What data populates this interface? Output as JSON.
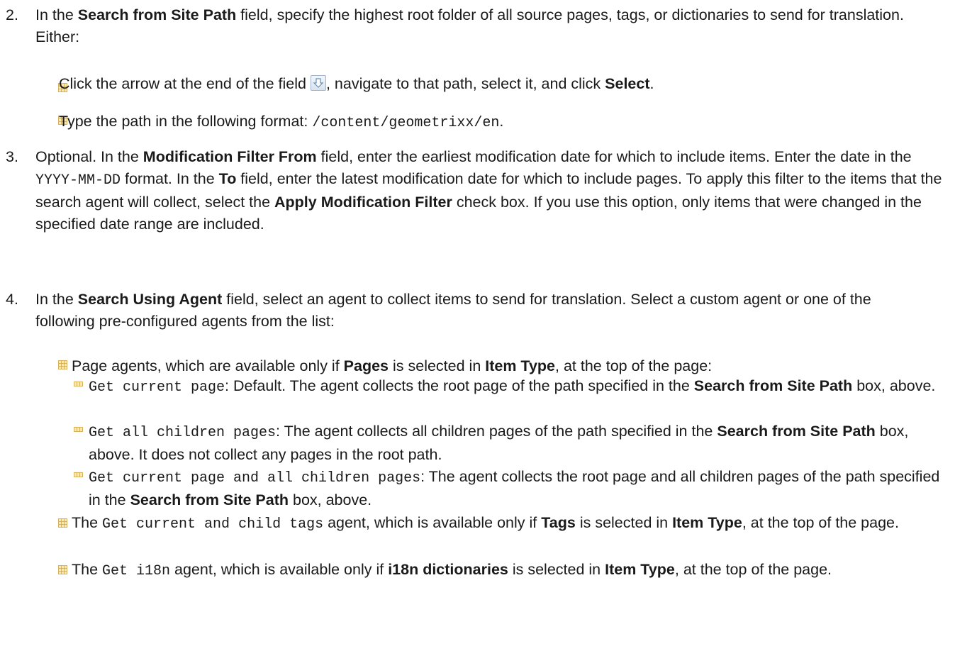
{
  "step2": {
    "num": "2.",
    "p1": "In the ",
    "b1": "Search from Site Path",
    "p2": " field, specify the highest root folder of all source pages, tags, or dictionaries to send for translation. Either:",
    "bullets": [
      {
        "p1": "Click the arrow at the end of the field ",
        "p2": ", navigate to that path, select it, and click ",
        "b1": "Select",
        "p3": "."
      },
      {
        "p1": "Type the path in the following format: ",
        "code": "/content/geometrixx/en",
        "p2": "."
      }
    ]
  },
  "step3": {
    "num": "3.",
    "p1": "Optional. In the ",
    "b1": "Modification Filter From",
    "p2": " field, enter the earliest modification date for which to include items. Enter the date in the ",
    "code": "YYYY-MM-DD",
    "p3": " format. In the ",
    "b2": "To",
    "p4": " field, enter the latest modification date for which to include pages. To apply this filter to the items that the search agent will collect, select the ",
    "b3": "Apply Modification Filter",
    "p5": " check box. If you use this option, only items that were changed in the specified date range are included."
  },
  "step4": {
    "num": "4.",
    "p1": "In the ",
    "b1": "Search Using Agent",
    "p2": " field, select an agent to collect items to send for translation. Select a custom agent or one of the following pre-configured agents from the list:",
    "page_agents": {
      "p1": "Page agents, which are available only if ",
      "b1": "Pages",
      "p2": " is selected in ",
      "b2": "Item Type",
      "p3": ", at the top of the page:",
      "items": [
        {
          "code": "Get current page",
          "p1": ": Default. The agent collects the root page of the path specified in the ",
          "b1": "Search from Site Path",
          "p2": " box, above."
        },
        {
          "code": "Get all children pages",
          "p1": ": The agent collects all children pages of the path specified in the ",
          "b1": "Search from Site Path",
          "p2": " box, above. It does not collect any pages in the root path."
        },
        {
          "code": "Get current page and all children pages",
          "p1": ": The agent collects the root page and all children pages of the path specified in the ",
          "b1": "Search from Site Path",
          "p2": " box, above."
        }
      ]
    },
    "tags_agent": {
      "p1": "The ",
      "code": "Get current and child tags",
      "p2": " agent, which is available only if ",
      "b1": "Tags",
      "p3": " is selected in ",
      "b2": "Item Type",
      "p4": ", at the top of the page."
    },
    "i18n_agent": {
      "p1": "The ",
      "code": "Get i18n",
      "p2": " agent, which is available only if ",
      "b1": "i18n dictionaries",
      "p3": " is selected in ",
      "b2": "Item Type",
      "p4": ", at the top of the page."
    }
  },
  "icons": {
    "bullet": "square-grid-bullet-icon",
    "arrow_button": "down-arrow-icon"
  },
  "colors": {
    "bullet": "#d7b25a",
    "text": "#1a1a1a"
  }
}
